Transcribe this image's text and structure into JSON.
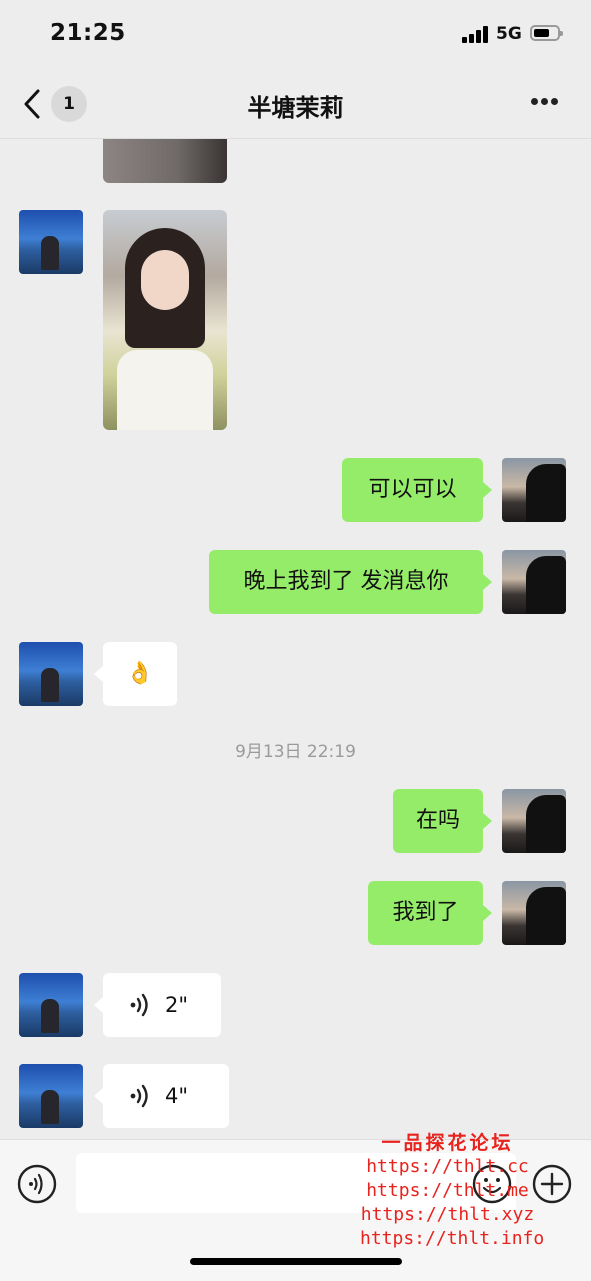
{
  "status_bar": {
    "time": "21:25",
    "network": "5G"
  },
  "header": {
    "unread_count": "1",
    "title": "半塘茉莉"
  },
  "messages": [
    {
      "side": "right",
      "text": "可以可以"
    },
    {
      "side": "right",
      "text": "晚上我到了 发消息你"
    },
    {
      "side": "left",
      "emoji": "👌"
    },
    {
      "side": "right",
      "text": "在吗"
    },
    {
      "side": "right",
      "text": "我到了"
    },
    {
      "side": "left",
      "voice_duration": "2\""
    },
    {
      "side": "left",
      "voice_duration": "4\""
    }
  ],
  "timestamp": "9月13日 22:19",
  "watermark": {
    "title": "一品探花论坛",
    "urls": [
      "https://thlt.cc",
      "https://thlt.me",
      "https://thlt.xyz",
      "https://thlt.info"
    ]
  },
  "colors": {
    "background": "#ededed",
    "sent_bubble": "#95ec69",
    "received_bubble": "#ffffff",
    "watermark": "#e8231e"
  },
  "icons": [
    "back-chevron-icon",
    "more-icon",
    "voice-wave-icon",
    "emoji-icon",
    "plus-icon"
  ]
}
